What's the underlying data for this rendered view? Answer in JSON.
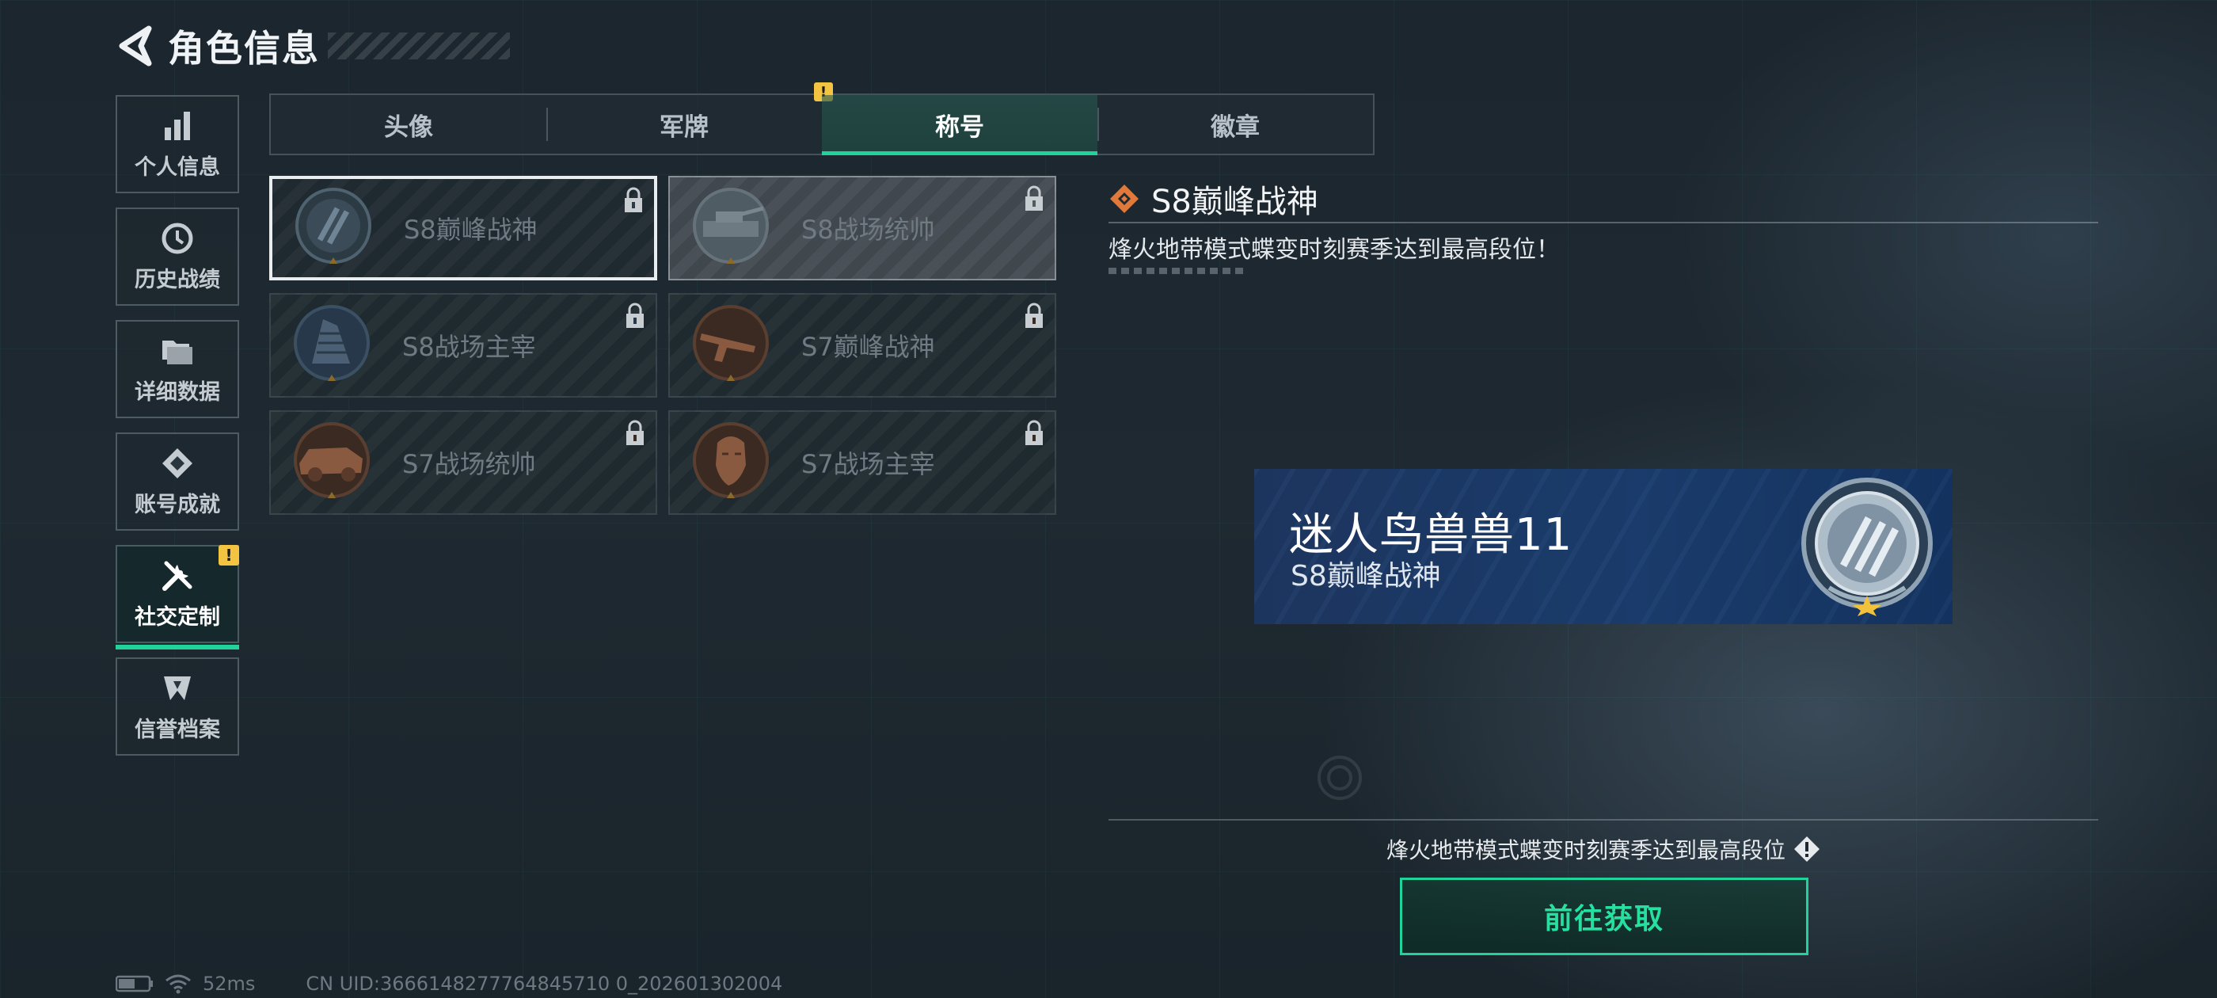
{
  "header": {
    "title": "角色信息",
    "back_icon": "back-arrow-icon"
  },
  "sidebar": {
    "items": [
      {
        "label": "个人信息",
        "icon": "bar-chart-icon",
        "active": false,
        "badge": ""
      },
      {
        "label": "历史战绩",
        "icon": "history-icon",
        "active": false,
        "badge": ""
      },
      {
        "label": "详细数据",
        "icon": "folder-icon",
        "active": false,
        "badge": ""
      },
      {
        "label": "账号成就",
        "icon": "achievement-icon",
        "active": false,
        "badge": ""
      },
      {
        "label": "社交定制",
        "icon": "tools-icon",
        "active": true,
        "badge": "!"
      },
      {
        "label": "信誉档案",
        "icon": "credit-icon",
        "active": false,
        "badge": ""
      }
    ]
  },
  "tabs": [
    {
      "label": "头像",
      "active": false,
      "badge": ""
    },
    {
      "label": "军牌",
      "active": false,
      "badge": "!"
    },
    {
      "label": "称号",
      "active": true,
      "badge": ""
    },
    {
      "label": "徽章",
      "active": false,
      "badge": ""
    }
  ],
  "titles": [
    {
      "name": "S8巅峰战神",
      "emblem": "s8-peak-emblem",
      "locked": true,
      "selected": true
    },
    {
      "name": "S8战场统帅",
      "emblem": "tank-emblem",
      "locked": true,
      "selected": false
    },
    {
      "name": "S8战场主宰",
      "emblem": "building-emblem",
      "locked": true,
      "selected": false
    },
    {
      "name": "S7巅峰战神",
      "emblem": "gun-emblem",
      "locked": true,
      "selected": false
    },
    {
      "name": "S7战场统帅",
      "emblem": "vehicle-emblem",
      "locked": true,
      "selected": false
    },
    {
      "name": "S7战场主宰",
      "emblem": "soldier-emblem",
      "locked": true,
      "selected": false
    }
  ],
  "detail": {
    "title": "S8巅峰战神",
    "description": "烽火地带模式蝶变时刻赛季达到最高段位！",
    "preview_player_name": "迷人鸟兽兽11",
    "preview_title": "S8巅峰战神",
    "condition": "烽火地带模式蝶变时刻赛季达到最高段位",
    "get_button": "前往获取"
  },
  "status": {
    "latency": "52ms",
    "uid": "CN UID:3666148277764845710 0_202601302004"
  },
  "colors": {
    "accent": "#1fd39a",
    "badge": "#f3c442",
    "title_icon": "#e0793a"
  }
}
